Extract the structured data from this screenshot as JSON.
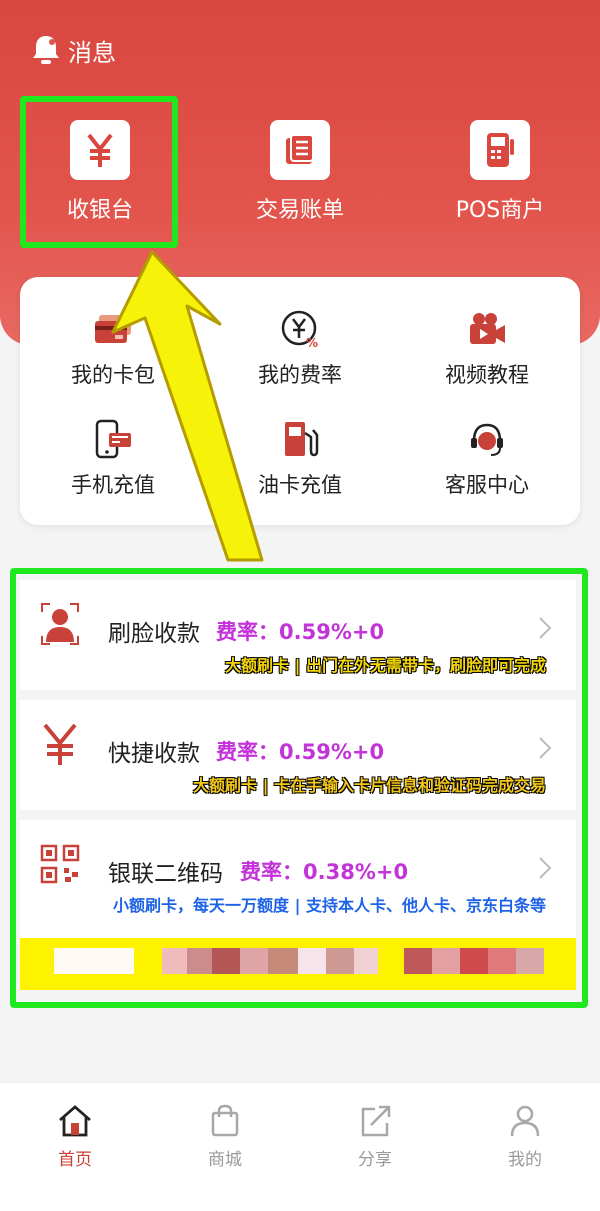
{
  "header": {
    "message_label": "消息"
  },
  "top_actions": [
    {
      "label": "收银台",
      "icon": "yen-icon"
    },
    {
      "label": "交易账单",
      "icon": "bill-icon"
    },
    {
      "label": "POS商户",
      "icon": "pos-terminal-icon"
    }
  ],
  "grid": [
    {
      "label": "我的卡包",
      "icon": "card-wallet-icon"
    },
    {
      "label": "我的费率",
      "icon": "fee-rate-icon"
    },
    {
      "label": "视频教程",
      "icon": "video-camera-icon"
    },
    {
      "label": "手机充值",
      "icon": "phone-recharge-icon"
    },
    {
      "label": "油卡充值",
      "icon": "fuel-pump-icon"
    },
    {
      "label": "客服中心",
      "icon": "headset-icon"
    }
  ],
  "payments": [
    {
      "name": "刷脸收款",
      "rate": "费率：0.59%+0",
      "desc": "大额刷卡 | 出门在外无需带卡，刷脸即可完成",
      "desc_color": "#f5d60a",
      "icon": "face-pay-icon"
    },
    {
      "name": "快捷收款",
      "rate": "费率：0.59%+0",
      "desc": "大额刷卡 | 卡在手输入卡片信息和验证码完成交易",
      "desc_color": "#f4c81b",
      "icon": "yen-icon"
    },
    {
      "name": "银联二维码",
      "rate": "费率：0.38%+0",
      "desc": "小额刷卡，每天一万额度 | 支持本人卡、他人卡、京东白条等",
      "desc_color": "#1e63e6",
      "icon": "qr-code-icon"
    }
  ],
  "tabs": [
    {
      "label": "首页",
      "icon": "home-icon",
      "active": true
    },
    {
      "label": "商城",
      "icon": "shopping-bag-icon",
      "active": false
    },
    {
      "label": "分享",
      "icon": "share-icon",
      "active": false
    },
    {
      "label": "我的",
      "icon": "profile-icon",
      "active": false
    }
  ],
  "colors": {
    "brand_red": "#d9473f",
    "highlight_green": "#1fe81f",
    "rate_purple": "#c233d8",
    "annotation_arrow": "#f7f20a"
  }
}
